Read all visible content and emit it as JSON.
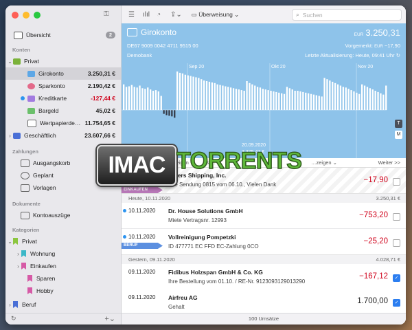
{
  "sidebar": {
    "overview": {
      "label": "Übersicht",
      "badge": "2"
    },
    "sections": {
      "accounts": "Konten",
      "payments": "Zahlungen",
      "documents": "Dokumente",
      "categories": "Kategorien"
    },
    "accounts": [
      {
        "label": "Privat"
      },
      {
        "label": "Girokonto",
        "amount": "3.250,31 €"
      },
      {
        "label": "Sparkonto",
        "amount": "2.190,42 €"
      },
      {
        "label": "Kreditkarte",
        "amount": "-127,44 €"
      },
      {
        "label": "Bargeld",
        "amount": "45,02 €"
      },
      {
        "label": "Wertpapierde…",
        "amount": "11.754,65 €"
      },
      {
        "label": "Geschäftlich",
        "amount": "23.607,66 €"
      }
    ],
    "payments": [
      {
        "label": "Ausgangskorb"
      },
      {
        "label": "Geplant"
      },
      {
        "label": "Vorlagen"
      }
    ],
    "documents": [
      {
        "label": "Kontoauszüge"
      }
    ],
    "categories": [
      {
        "label": "Privat",
        "color": "#8cc63f"
      },
      {
        "label": "Wohnung",
        "color": "#3cb8c8"
      },
      {
        "label": "Einkaufen",
        "color": "#d65aa6"
      },
      {
        "label": "Sparen",
        "color": "#d65aa6"
      },
      {
        "label": "Hobby",
        "color": "#d65aa6"
      },
      {
        "label": "Beruf",
        "color": "#4a6fd6"
      }
    ]
  },
  "toolbar": {
    "transfer_label": "Überweisung",
    "search_placeholder": "Suchen"
  },
  "account": {
    "name": "Girokonto",
    "iban": "DE67 9009 0042 4711 9515 00",
    "bank": "Demobank",
    "currency_label": "EUR",
    "balance_main": "3.250",
    "balance_cents": ",31",
    "reserved_label": "Vorgemerkt:",
    "reserved_currency": "EUR",
    "reserved_value": "−17,90",
    "updated": "Letzte Aktualisierung: Heute, 09:41 Uhr",
    "tooltip_date": "20.09.2020",
    "tooltip_value": "3.375,47 €",
    "toggle_t": "T",
    "toggle_m": "M"
  },
  "chart_data": {
    "type": "bar",
    "x_labels": [
      "Sep 20",
      "Okt 20",
      "Nov 20"
    ],
    "values": [
      40,
      36,
      37,
      39,
      36,
      35,
      38,
      34,
      33,
      35,
      32,
      30,
      31,
      29,
      22,
      -6,
      -8,
      -9,
      -10,
      -12,
      60,
      58,
      57,
      55,
      54,
      53,
      52,
      51,
      50,
      48,
      46,
      45,
      44,
      43,
      42,
      40,
      39,
      38,
      37,
      36,
      35,
      34,
      33,
      32,
      31,
      30,
      45,
      42,
      40,
      38,
      36,
      35,
      33,
      32,
      31,
      30,
      29,
      28,
      27,
      26,
      25,
      36,
      34,
      32,
      30,
      30,
      29,
      28,
      27,
      26,
      25,
      24,
      23,
      22,
      21,
      50,
      48,
      46,
      44,
      42,
      40,
      38,
      36,
      35,
      33,
      31,
      29,
      27,
      25,
      40,
      38,
      36,
      34,
      32,
      30,
      28,
      26,
      24,
      38
    ],
    "ylim": [
      -20,
      100
    ]
  },
  "columns": {
    "left_tail": "…eigen ⌄",
    "mid": "St…",
    "right_tail": "…zeigen ⌄",
    "more": "Weiter >>"
  },
  "sections": [
    {
      "label": "Heute, 10.11.2020",
      "total": "3.250,31 €"
    },
    {
      "label": "Gestern, 09.11.2020",
      "total": "4.028,71 €"
    }
  ],
  "transactions": [
    {
      "date": "",
      "party": "…gers Shipping, Inc.",
      "purpose": "Ihre Sendung 0815 vom 06.10., Vielen Dank",
      "amount": "−17,90",
      "tag": "EINKAUFEN"
    },
    {
      "date": "10.11.2020",
      "party": "Dr. House Solutions GmbH",
      "purpose": "Miete Vertragsnr. 12993",
      "amount": "−753,20",
      "tag": ""
    },
    {
      "date": "10.11.2020",
      "party": "Vollreinigung Pompetzki",
      "purpose": "ID 477771 EC FFD EC-Zahlung 0CO",
      "amount": "−25,20",
      "tag": "BERUF"
    },
    {
      "date": "09.11.2020",
      "party": "Fidibus Holzspan GmbH & Co. KG",
      "purpose": "Ihre Bestellung vom 01.10. / RE-Nr. 9123093129013290",
      "amount": "−167,12",
      "tag": ""
    },
    {
      "date": "09.11.2020",
      "party": "Airfreu AG",
      "purpose": "Gehalt",
      "amount": "1.700,00",
      "tag": ""
    }
  ],
  "footer": {
    "count": "100 Umsätze"
  },
  "watermark": {
    "left": "IMAC",
    "right": "TORRENTS"
  }
}
